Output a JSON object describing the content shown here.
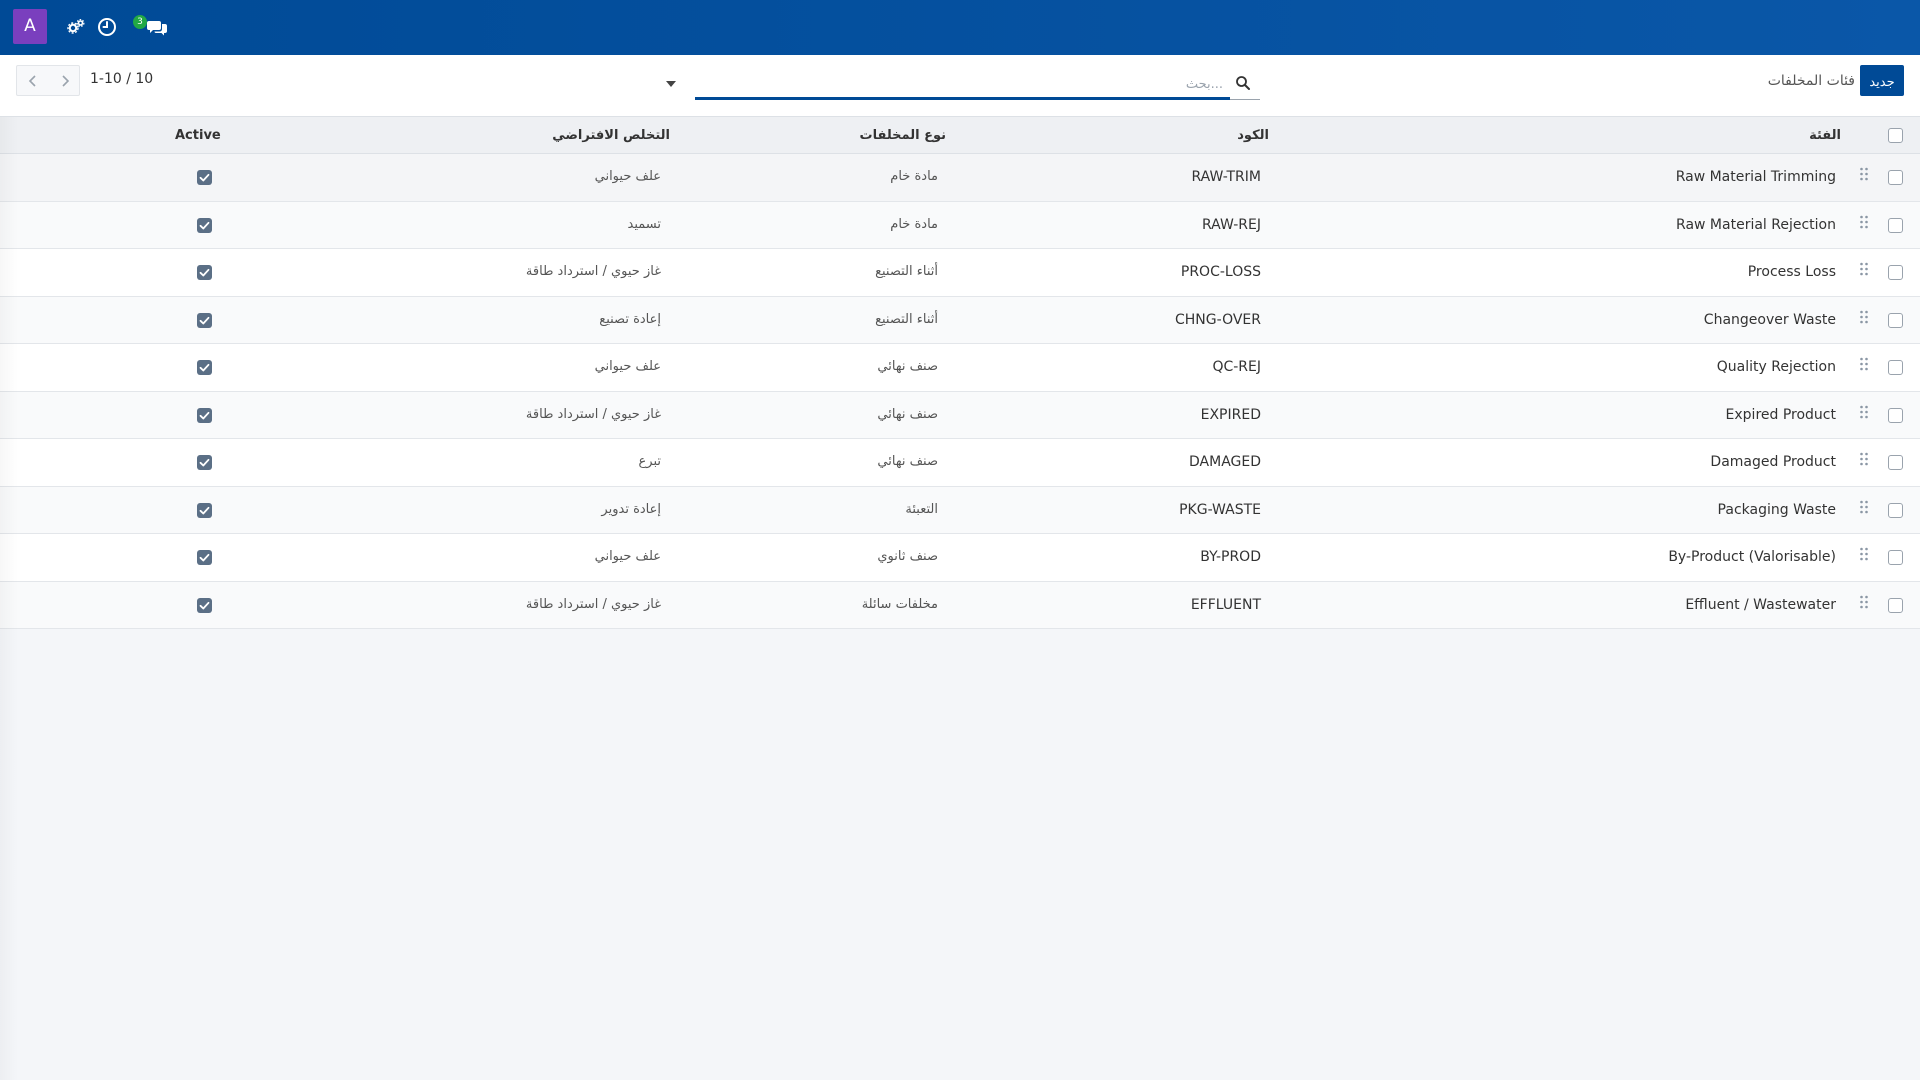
{
  "navbar": {
    "avatar_letter": "A",
    "icons": [
      "settings-icon",
      "clock-icon",
      "chat-icon"
    ],
    "chat_badge": "3"
  },
  "control_panel": {
    "new_label": "جديد",
    "title": "فئات المخلفات",
    "search_placeholder": "...بحث",
    "pager_counter": "1-10 / 10"
  },
  "table": {
    "headers": {
      "category": "الفئة",
      "code": "الكود",
      "waste_type": "نوع المخلفات",
      "default_disposal": "التخلص الافتراضي",
      "active": "Active"
    },
    "rows": [
      {
        "category": "Raw Material Trimming",
        "code": "RAW-TRIM",
        "waste_type": "مادة خام",
        "default_disposal": "علف حيواني",
        "active": true
      },
      {
        "category": "Raw Material Rejection",
        "code": "RAW-REJ",
        "waste_type": "مادة خام",
        "default_disposal": "تسميد",
        "active": true
      },
      {
        "category": "Process Loss",
        "code": "PROC-LOSS",
        "waste_type": "أثناء التصنيع",
        "default_disposal": "غاز حيوي / استرداد طاقة",
        "active": true
      },
      {
        "category": "Changeover Waste",
        "code": "CHNG-OVER",
        "waste_type": "أثناء التصنيع",
        "default_disposal": "إعادة تصنيع",
        "active": true
      },
      {
        "category": "Quality Rejection",
        "code": "QC-REJ",
        "waste_type": "صنف نهائي",
        "default_disposal": "علف حيواني",
        "active": true
      },
      {
        "category": "Expired Product",
        "code": "EXPIRED",
        "waste_type": "صنف نهائي",
        "default_disposal": "غاز حيوي / استرداد طاقة",
        "active": true
      },
      {
        "category": "Damaged Product",
        "code": "DAMAGED",
        "waste_type": "صنف نهائي",
        "default_disposal": "تبرع",
        "active": true
      },
      {
        "category": "Packaging Waste",
        "code": "PKG-WASTE",
        "waste_type": "التعبئة",
        "default_disposal": "إعادة تدوير",
        "active": true
      },
      {
        "category": "By-Product (Valorisable)",
        "code": "BY-PROD",
        "waste_type": "صنف ثانوي",
        "default_disposal": "علف حيواني",
        "active": true
      },
      {
        "category": "Effluent / Wastewater",
        "code": "EFFLUENT",
        "waste_type": "مخلفات سائلة",
        "default_disposal": "غاز حيوي / استرداد طاقة",
        "active": true
      }
    ]
  },
  "colors": {
    "navbar": "#004a96",
    "avatar": "#7a3fbe",
    "badge": "#22a845",
    "primary_button": "#004a96",
    "active_check": "#5b6f86"
  }
}
